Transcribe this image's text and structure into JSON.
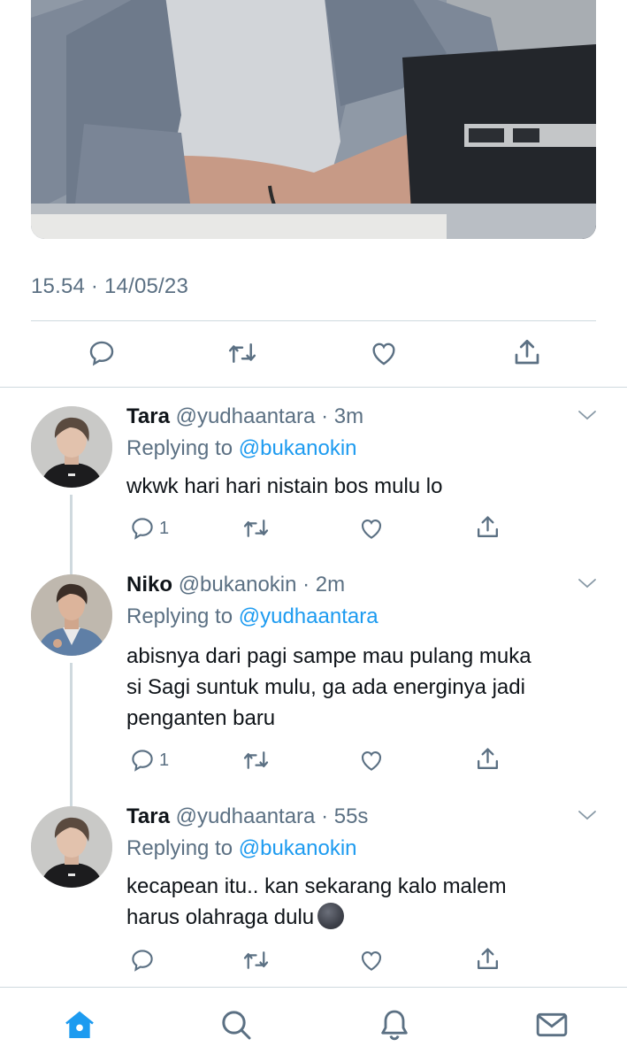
{
  "tweet": {
    "timestamp": "15.54 · 14/05/23"
  },
  "replies": [
    {
      "name": "Tara",
      "handle": "@yudhaantara",
      "time": "· 3m",
      "replying_prefix": "Replying to",
      "replying_to": "@bukanokin",
      "text_lines": [
        "wkwk hari hari nistain bos mulu lo"
      ],
      "reply_count": "1"
    },
    {
      "name": "Niko",
      "handle": "@bukanokin",
      "time": "· 2m",
      "replying_prefix": "Replying to",
      "replying_to": "@yudhaantara",
      "text_lines": [
        "abisnya dari pagi sampe mau pulang muka",
        "si Sagi suntuk mulu, ga ada energinya jadi",
        "penganten baru"
      ],
      "reply_count": "1"
    },
    {
      "name": "Tara",
      "handle": "@yudhaantara",
      "time": "· 55s",
      "replying_prefix": "Replying to",
      "replying_to": "@bukanokin",
      "text_lines": [
        "kecapean itu.. kan sekarang kalo malem",
        "harus olahraga dulu"
      ],
      "emoji": "new-moon-face",
      "reply_count": ""
    }
  ],
  "icons": {
    "reply": "reply-icon",
    "retweet": "retweet-icon",
    "like": "heart-icon",
    "share": "share-icon",
    "caret": "chevron-down-icon",
    "home": "home-icon",
    "search": "search-icon",
    "notifications": "bell-icon",
    "messages": "mail-icon"
  },
  "colors": {
    "accent": "#1d9bf0",
    "secondary_text": "#5b7083",
    "divider": "#cfd9de"
  }
}
